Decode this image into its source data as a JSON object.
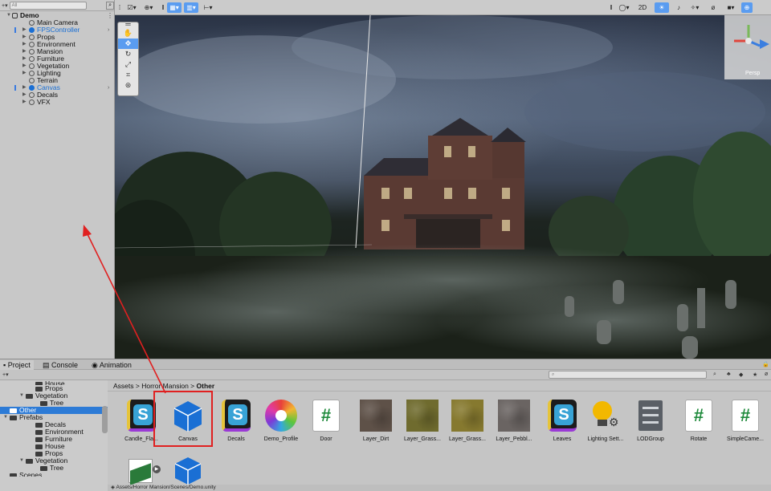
{
  "hierarchy": {
    "search_placeholder": "All",
    "scene_name": "Demo",
    "items": [
      {
        "label": "Main Camera",
        "expandable": false
      },
      {
        "label": "FPSController",
        "expandable": true,
        "prefab": true
      },
      {
        "label": "Props",
        "expandable": true
      },
      {
        "label": "Environment",
        "expandable": true
      },
      {
        "label": "Mansion",
        "expandable": true
      },
      {
        "label": "Furniture",
        "expandable": true
      },
      {
        "label": "Vegetation",
        "expandable": true
      },
      {
        "label": "Lighting",
        "expandable": true
      },
      {
        "label": "Terrain",
        "expandable": false
      },
      {
        "label": "Canvas",
        "expandable": true,
        "prefab": true
      },
      {
        "label": "Decals",
        "expandable": true
      },
      {
        "label": "VFX",
        "expandable": true
      }
    ]
  },
  "scene_toolbar": {
    "mode_2d": "2D",
    "gizmo_label": "Persp"
  },
  "bottom_tabs": [
    "Project",
    "Console",
    "Animation"
  ],
  "folders": [
    {
      "label": "House",
      "depth": 3,
      "cut": true
    },
    {
      "label": "Props",
      "depth": 3
    },
    {
      "label": "Vegetation",
      "depth": 2,
      "open": true
    },
    {
      "label": "Tree",
      "depth": 4
    },
    {
      "label": "Other",
      "depth": 1,
      "selected": true
    },
    {
      "label": "Prefabs",
      "depth": 1,
      "open": true
    },
    {
      "label": "Decals",
      "depth": 3
    },
    {
      "label": "Environment",
      "depth": 3
    },
    {
      "label": "Furniture",
      "depth": 3
    },
    {
      "label": "House",
      "depth": 3
    },
    {
      "label": "Props",
      "depth": 3
    },
    {
      "label": "Vegetation",
      "depth": 2,
      "open": true
    },
    {
      "label": "Tree",
      "depth": 4
    },
    {
      "label": "Scenes",
      "depth": 1,
      "cut": true
    }
  ],
  "breadcrumb": {
    "root": "Assets",
    "mid": "Horror Mansion",
    "current": "Other"
  },
  "assets": [
    {
      "name": "Candle_Fla...",
      "kind": "shader"
    },
    {
      "name": "Canvas",
      "kind": "prefab",
      "highlighted": true
    },
    {
      "name": "Decals",
      "kind": "shader"
    },
    {
      "name": "Demo_Profile",
      "kind": "profile"
    },
    {
      "name": "Door",
      "kind": "script"
    },
    {
      "name": "Layer_Dirt",
      "kind": "texture",
      "color": "#5e5148"
    },
    {
      "name": "Layer_Grass...",
      "kind": "texture",
      "color": "#6f6b2e"
    },
    {
      "name": "Layer_Grass...",
      "kind": "texture",
      "color": "#86792f"
    },
    {
      "name": "Layer_Pebbl...",
      "kind": "texture",
      "color": "#6a6462"
    },
    {
      "name": "Leaves",
      "kind": "shader"
    },
    {
      "name": "Lighting Sett...",
      "kind": "lighting"
    },
    {
      "name": "LODGroup",
      "kind": "lodgroup"
    },
    {
      "name": "Rotate",
      "kind": "script"
    },
    {
      "name": "SimpleCame...",
      "kind": "script"
    }
  ],
  "status_path": "Assets/Horror Mansion/Scenes/Demo.unity",
  "colors": {
    "accent": "#2d7bd6",
    "highlight": "#e02020",
    "prefab_blue": "#1a6fd4"
  }
}
